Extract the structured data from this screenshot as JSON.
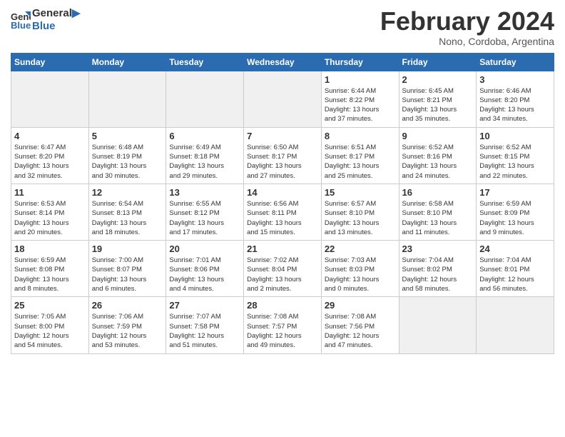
{
  "header": {
    "logo_line1": "General",
    "logo_line2": "Blue",
    "month_title": "February 2024",
    "subtitle": "Nono, Cordoba, Argentina"
  },
  "days_of_week": [
    "Sunday",
    "Monday",
    "Tuesday",
    "Wednesday",
    "Thursday",
    "Friday",
    "Saturday"
  ],
  "weeks": [
    [
      {
        "num": "",
        "info": ""
      },
      {
        "num": "",
        "info": ""
      },
      {
        "num": "",
        "info": ""
      },
      {
        "num": "",
        "info": ""
      },
      {
        "num": "1",
        "info": "Sunrise: 6:44 AM\nSunset: 8:22 PM\nDaylight: 13 hours\nand 37 minutes."
      },
      {
        "num": "2",
        "info": "Sunrise: 6:45 AM\nSunset: 8:21 PM\nDaylight: 13 hours\nand 35 minutes."
      },
      {
        "num": "3",
        "info": "Sunrise: 6:46 AM\nSunset: 8:20 PM\nDaylight: 13 hours\nand 34 minutes."
      }
    ],
    [
      {
        "num": "4",
        "info": "Sunrise: 6:47 AM\nSunset: 8:20 PM\nDaylight: 13 hours\nand 32 minutes."
      },
      {
        "num": "5",
        "info": "Sunrise: 6:48 AM\nSunset: 8:19 PM\nDaylight: 13 hours\nand 30 minutes."
      },
      {
        "num": "6",
        "info": "Sunrise: 6:49 AM\nSunset: 8:18 PM\nDaylight: 13 hours\nand 29 minutes."
      },
      {
        "num": "7",
        "info": "Sunrise: 6:50 AM\nSunset: 8:17 PM\nDaylight: 13 hours\nand 27 minutes."
      },
      {
        "num": "8",
        "info": "Sunrise: 6:51 AM\nSunset: 8:17 PM\nDaylight: 13 hours\nand 25 minutes."
      },
      {
        "num": "9",
        "info": "Sunrise: 6:52 AM\nSunset: 8:16 PM\nDaylight: 13 hours\nand 24 minutes."
      },
      {
        "num": "10",
        "info": "Sunrise: 6:52 AM\nSunset: 8:15 PM\nDaylight: 13 hours\nand 22 minutes."
      }
    ],
    [
      {
        "num": "11",
        "info": "Sunrise: 6:53 AM\nSunset: 8:14 PM\nDaylight: 13 hours\nand 20 minutes."
      },
      {
        "num": "12",
        "info": "Sunrise: 6:54 AM\nSunset: 8:13 PM\nDaylight: 13 hours\nand 18 minutes."
      },
      {
        "num": "13",
        "info": "Sunrise: 6:55 AM\nSunset: 8:12 PM\nDaylight: 13 hours\nand 17 minutes."
      },
      {
        "num": "14",
        "info": "Sunrise: 6:56 AM\nSunset: 8:11 PM\nDaylight: 13 hours\nand 15 minutes."
      },
      {
        "num": "15",
        "info": "Sunrise: 6:57 AM\nSunset: 8:10 PM\nDaylight: 13 hours\nand 13 minutes."
      },
      {
        "num": "16",
        "info": "Sunrise: 6:58 AM\nSunset: 8:10 PM\nDaylight: 13 hours\nand 11 minutes."
      },
      {
        "num": "17",
        "info": "Sunrise: 6:59 AM\nSunset: 8:09 PM\nDaylight: 13 hours\nand 9 minutes."
      }
    ],
    [
      {
        "num": "18",
        "info": "Sunrise: 6:59 AM\nSunset: 8:08 PM\nDaylight: 13 hours\nand 8 minutes."
      },
      {
        "num": "19",
        "info": "Sunrise: 7:00 AM\nSunset: 8:07 PM\nDaylight: 13 hours\nand 6 minutes."
      },
      {
        "num": "20",
        "info": "Sunrise: 7:01 AM\nSunset: 8:06 PM\nDaylight: 13 hours\nand 4 minutes."
      },
      {
        "num": "21",
        "info": "Sunrise: 7:02 AM\nSunset: 8:04 PM\nDaylight: 13 hours\nand 2 minutes."
      },
      {
        "num": "22",
        "info": "Sunrise: 7:03 AM\nSunset: 8:03 PM\nDaylight: 13 hours\nand 0 minutes."
      },
      {
        "num": "23",
        "info": "Sunrise: 7:04 AM\nSunset: 8:02 PM\nDaylight: 12 hours\nand 58 minutes."
      },
      {
        "num": "24",
        "info": "Sunrise: 7:04 AM\nSunset: 8:01 PM\nDaylight: 12 hours\nand 56 minutes."
      }
    ],
    [
      {
        "num": "25",
        "info": "Sunrise: 7:05 AM\nSunset: 8:00 PM\nDaylight: 12 hours\nand 54 minutes."
      },
      {
        "num": "26",
        "info": "Sunrise: 7:06 AM\nSunset: 7:59 PM\nDaylight: 12 hours\nand 53 minutes."
      },
      {
        "num": "27",
        "info": "Sunrise: 7:07 AM\nSunset: 7:58 PM\nDaylight: 12 hours\nand 51 minutes."
      },
      {
        "num": "28",
        "info": "Sunrise: 7:08 AM\nSunset: 7:57 PM\nDaylight: 12 hours\nand 49 minutes."
      },
      {
        "num": "29",
        "info": "Sunrise: 7:08 AM\nSunset: 7:56 PM\nDaylight: 12 hours\nand 47 minutes."
      },
      {
        "num": "",
        "info": ""
      },
      {
        "num": "",
        "info": ""
      }
    ]
  ]
}
